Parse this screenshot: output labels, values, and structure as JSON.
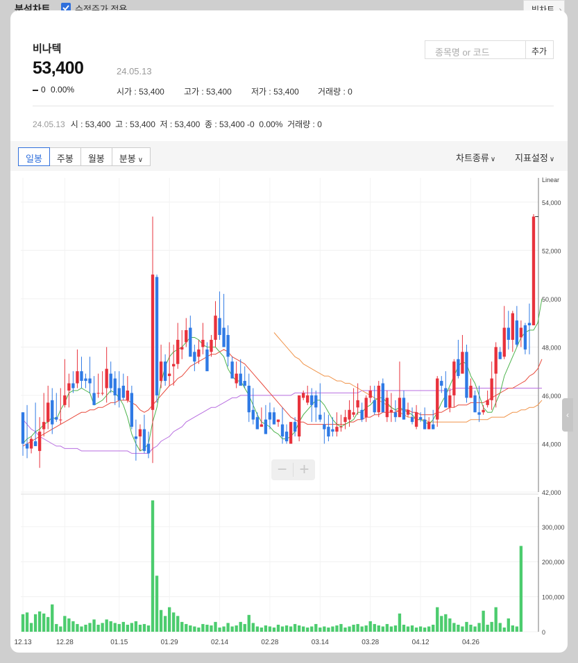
{
  "header": {
    "title": "분석차트",
    "adjusted_label": "수정주가 적용",
    "big_chart_label": "빅차트"
  },
  "stock": {
    "name": "비나텍",
    "price": "53,400",
    "date": "24.05.13",
    "change": "0",
    "change_pct": "0.00%",
    "open": "시가 : 53,400",
    "high": "고가 : 53,400",
    "low": "저가 : 53,400",
    "volume": "거래량 : 0"
  },
  "search": {
    "placeholder": "종목명 or 코드",
    "add_label": "추가"
  },
  "summary": {
    "date": "24.05.13",
    "text": "시 : 53,400  고 : 53,400  저 : 53,400  종 : 53,400 -0  0.00%  거래량 : 0"
  },
  "toolbar": {
    "periods": [
      "일봉",
      "주봉",
      "월봉",
      "분봉"
    ],
    "active_period": "일봉",
    "chart_type": "차트종류",
    "indicator": "지표설정"
  },
  "chart_data": {
    "type": "candlestick",
    "scale_label": "Linear",
    "price_ticks": [
      "54,000",
      "52,000",
      "50,000",
      "48,000",
      "46,000",
      "44,000",
      "42,000"
    ],
    "volume_ticks": [
      "300,000",
      "200,000",
      "100,000",
      "0"
    ],
    "x_labels": [
      "12.13",
      "12.28",
      "01.15",
      "01.29",
      "02.14",
      "02.28",
      "03.14",
      "03.28",
      "04.12",
      "04.26"
    ],
    "ylim": [
      42000,
      55000
    ],
    "volume_ylim": [
      0,
      385000
    ],
    "colors": {
      "up": "#e8323c",
      "down": "#2f7ae5",
      "ma5": "#4cb34c",
      "ma20": "#e84a3c",
      "ma60": "#f0944a",
      "ma120": "#b86ee0",
      "volume": "#4ccc6e"
    },
    "candles": [
      [
        45300,
        45300,
        43500,
        44000
      ],
      [
        44000,
        45600,
        43400,
        43800
      ],
      [
        43800,
        44300,
        43600,
        44200
      ],
      [
        44100,
        45700,
        43900,
        43900
      ],
      [
        43700,
        45100,
        43000,
        44500
      ],
      [
        44600,
        46100,
        44300,
        44900
      ],
      [
        44900,
        46400,
        44600,
        45700
      ],
      [
        45800,
        46300,
        44400,
        44800
      ],
      [
        45100,
        46100,
        44900,
        45000
      ],
      [
        45000,
        46300,
        44800,
        45000
      ],
      [
        45600,
        47500,
        45500,
        46000
      ],
      [
        46200,
        46900,
        45500,
        46500
      ],
      [
        46500,
        47000,
        46100,
        46300
      ],
      [
        46500,
        47900,
        46300,
        47000
      ],
      [
        47000,
        47600,
        46300,
        46600
      ],
      [
        46700,
        46900,
        46300,
        46600
      ],
      [
        46700,
        47600,
        46100,
        46500
      ],
      [
        46100,
        46800,
        45600,
        45600
      ],
      [
        46100,
        46900,
        45900,
        46100
      ],
      [
        46100,
        47000,
        46000,
        46100
      ],
      [
        46300,
        48000,
        45700,
        47100
      ],
      [
        46900,
        47400,
        46100,
        46300
      ],
      [
        46700,
        47000,
        45600,
        46000
      ],
      [
        46300,
        47000,
        45500,
        45800
      ],
      [
        46400,
        46900,
        45800,
        45900
      ],
      [
        45800,
        46800,
        45700,
        46200
      ],
      [
        46100,
        46400,
        44600,
        44700
      ],
      [
        44300,
        45000,
        43300,
        44200
      ],
      [
        44300,
        44800,
        43700,
        44600
      ],
      [
        44600,
        45200,
        43600,
        43700
      ],
      [
        44000,
        44500,
        43400,
        43600
      ],
      [
        45400,
        53400,
        43200,
        51000
      ],
      [
        50900,
        51000,
        45700,
        46000
      ],
      [
        46600,
        48100,
        46300,
        47400
      ],
      [
        47400,
        47700,
        46400,
        46600
      ],
      [
        46800,
        48200,
        46400,
        46900
      ],
      [
        47200,
        48100,
        46400,
        47300
      ],
      [
        47300,
        49000,
        47100,
        48300
      ],
      [
        47900,
        48700,
        47500,
        48000
      ],
      [
        48200,
        49200,
        48000,
        48700
      ],
      [
        48800,
        49300,
        48000,
        47600
      ],
      [
        47800,
        48100,
        47000,
        47400
      ],
      [
        47600,
        48300,
        47300,
        47900
      ],
      [
        48000,
        49000,
        47700,
        48300
      ],
      [
        47900,
        48200,
        47300,
        47000
      ],
      [
        47800,
        48500,
        47600,
        48300
      ],
      [
        48300,
        49900,
        48000,
        49300
      ],
      [
        49200,
        50300,
        48300,
        48500
      ],
      [
        48800,
        50200,
        48100,
        48000
      ],
      [
        48500,
        48900,
        47200,
        47600
      ],
      [
        47400,
        47600,
        46700,
        46700
      ],
      [
        46500,
        47400,
        46300,
        46900
      ],
      [
        46900,
        47500,
        46400,
        46400
      ],
      [
        46600,
        47200,
        46300,
        46400
      ],
      [
        46400,
        46900,
        44900,
        45300
      ],
      [
        45400,
        46300,
        44800,
        45000
      ],
      [
        45100,
        45300,
        44600,
        44600
      ],
      [
        44700,
        45500,
        44700,
        44800
      ],
      [
        45000,
        45600,
        44400,
        44400
      ],
      [
        45300,
        45700,
        44600,
        45000
      ],
      [
        45300,
        45500,
        44800,
        44800
      ],
      [
        44900,
        45000,
        44700,
        45000
      ],
      [
        44800,
        45500,
        44000,
        44300
      ],
      [
        44500,
        44800,
        44000,
        44100
      ],
      [
        44000,
        44900,
        44000,
        44900
      ],
      [
        44900,
        45100,
        44300,
        44500
      ],
      [
        44300,
        46000,
        44100,
        46000
      ],
      [
        45900,
        46200,
        45800,
        46100
      ],
      [
        45700,
        46400,
        45600,
        46000
      ],
      [
        46000,
        46300,
        44900,
        45600
      ],
      [
        46000,
        46200,
        44900,
        45500
      ],
      [
        45200,
        46500,
        44900,
        45000
      ],
      [
        44800,
        45300,
        44000,
        44600
      ],
      [
        44700,
        45200,
        44100,
        44300
      ],
      [
        44600,
        45100,
        44300,
        44500
      ],
      [
        44500,
        45300,
        44300,
        44700
      ],
      [
        44700,
        45200,
        44500,
        44700
      ],
      [
        44900,
        45400,
        44600,
        45100
      ],
      [
        45000,
        45800,
        44700,
        45400
      ],
      [
        45200,
        46300,
        45100,
        45300
      ],
      [
        45500,
        46500,
        45200,
        45800
      ],
      [
        45400,
        45700,
        44900,
        45000
      ],
      [
        45100,
        46000,
        44900,
        45900
      ],
      [
        45900,
        46400,
        45700,
        46200
      ],
      [
        45800,
        46400,
        45200,
        45300
      ],
      [
        45300,
        46600,
        45100,
        46400
      ],
      [
        46500,
        46700,
        45300,
        45300
      ],
      [
        45100,
        46200,
        44900,
        45900
      ],
      [
        45300,
        46100,
        44900,
        45400
      ],
      [
        45300,
        45800,
        44900,
        45100
      ],
      [
        45100,
        47400,
        45100,
        45900
      ],
      [
        45900,
        46200,
        45000,
        45000
      ],
      [
        45200,
        45700,
        45100,
        45400
      ],
      [
        45100,
        45500,
        44800,
        44900
      ],
      [
        44700,
        45600,
        44600,
        45300
      ],
      [
        45100,
        45300,
        44900,
        45000
      ],
      [
        45000,
        45500,
        44600,
        44600
      ],
      [
        44600,
        45100,
        44600,
        44900
      ],
      [
        44800,
        45400,
        44600,
        44600
      ],
      [
        45000,
        46800,
        44700,
        46700
      ],
      [
        46600,
        46800,
        46100,
        46400
      ],
      [
        46300,
        47000,
        45500,
        45500
      ],
      [
        45500,
        46300,
        45300,
        46000
      ],
      [
        46000,
        47500,
        45500,
        47400
      ],
      [
        47500,
        48300,
        46700,
        46800
      ],
      [
        46900,
        48500,
        46900,
        47800
      ],
      [
        47800,
        48100,
        45700,
        45900
      ],
      [
        45900,
        46700,
        45900,
        46400
      ],
      [
        46000,
        46200,
        45300,
        45300
      ],
      [
        45300,
        46400,
        44900,
        45200
      ],
      [
        45300,
        45600,
        45200,
        45400
      ],
      [
        45600,
        46200,
        45500,
        45800
      ],
      [
        45800,
        47400,
        45400,
        46700
      ],
      [
        46900,
        48200,
        45500,
        48000
      ],
      [
        47800,
        48000,
        47500,
        47500
      ],
      [
        47600,
        49700,
        47500,
        48800
      ],
      [
        48800,
        49500,
        47900,
        48300
      ],
      [
        48300,
        49500,
        47800,
        49400
      ],
      [
        49100,
        49700,
        48000,
        48100
      ],
      [
        48400,
        49100,
        48000,
        48800
      ],
      [
        48900,
        49000,
        47700,
        47900
      ],
      [
        49000,
        49800,
        47700,
        48900
      ],
      [
        48900,
        53500,
        48900,
        53400
      ]
    ],
    "ma5": [
      44000,
      44200,
      44300,
      44500,
      44600,
      44800,
      44900,
      45100,
      45000,
      45400,
      45700,
      46100,
      46200,
      46200,
      46300,
      46200,
      46100,
      45600,
      45700,
      45800,
      46000,
      46200,
      46100,
      45900,
      45600,
      45100,
      44400,
      44000,
      43700,
      43800,
      44000,
      44900,
      45500,
      46500,
      47200,
      47600,
      47800,
      47900,
      48000,
      48200,
      48400,
      48400,
      48300,
      48100,
      48000,
      48000,
      48000,
      47800,
      47600,
      47100,
      46800,
      46600,
      46600,
      46300,
      46000,
      45600,
      45200,
      44900,
      44800,
      44700,
      44500,
      44400,
      44200,
      44200,
      44300,
      44500,
      44900,
      45200,
      45400,
      45600,
      45800,
      45800,
      45600,
      45300,
      45000,
      44800,
      44700,
      44800,
      44900,
      45000,
      45300,
      45300,
      45500,
      45600,
      45800,
      45900,
      45900,
      45700,
      45500,
      45400,
      45500,
      45400,
      45300,
      45200,
      45000,
      45000,
      44900,
      44800,
      45000,
      45300,
      45700,
      46000,
      46400,
      46800,
      47200,
      47400,
      47300,
      46800,
      46500,
      46000,
      45500,
      45300,
      45300,
      45700,
      46100,
      46800,
      47200,
      47600,
      48000,
      48400,
      48600,
      48700,
      48700,
      49000,
      50000
    ],
    "ma20": [
      43900,
      44000,
      44100,
      44200,
      44300,
      44400,
      44500,
      44600,
      44700,
      44800,
      44900,
      45000,
      45100,
      45200,
      45300,
      45300,
      45400,
      45400,
      45500,
      45500,
      45600,
      45700,
      45700,
      45800,
      45800,
      45800,
      45700,
      45600,
      45400,
      45300,
      45400,
      45600,
      45800,
      46000,
      46200,
      46400,
      46500,
      46700,
      46800,
      47000,
      47200,
      47300,
      47400,
      47500,
      47600,
      47700,
      47700,
      47800,
      47900,
      47800,
      47600,
      47500,
      47400,
      47300,
      47100,
      46900,
      46700,
      46500,
      46300,
      46100,
      45900,
      45700,
      45500,
      45300,
      45100,
      45000,
      44900,
      44900,
      44800,
      44800,
      44800,
      44800,
      44800,
      44800,
      44800,
      44800,
      44800,
      44800,
      44900,
      44900,
      45000,
      45000,
      45100,
      45100,
      45200,
      45200,
      45300,
      45300,
      45300,
      45300,
      45400,
      45400,
      45400,
      45300,
      45300,
      45200,
      45200,
      45200,
      45200,
      45300,
      45300,
      45400,
      45500,
      45500,
      45600,
      45600,
      45600,
      45700,
      45700,
      45700,
      45700,
      45800,
      45900,
      46000,
      46100,
      46200,
      46300,
      46300,
      46400,
      46500,
      46600,
      46800,
      46900,
      47100,
      47500
    ],
    "ma60": [
      null,
      null,
      null,
      null,
      null,
      null,
      null,
      null,
      null,
      null,
      null,
      null,
      null,
      null,
      null,
      null,
      null,
      null,
      null,
      null,
      null,
      null,
      null,
      null,
      null,
      null,
      null,
      null,
      null,
      null,
      null,
      null,
      null,
      null,
      null,
      null,
      null,
      null,
      null,
      null,
      null,
      null,
      null,
      null,
      null,
      null,
      null,
      null,
      null,
      null,
      null,
      null,
      null,
      null,
      null,
      null,
      null,
      null,
      null,
      null,
      48600,
      48400,
      48200,
      48000,
      47800,
      47600,
      47500,
      47300,
      47200,
      47100,
      47000,
      46900,
      46800,
      46800,
      46700,
      46600,
      46600,
      46500,
      46500,
      46400,
      46300,
      46200,
      46100,
      46000,
      45900,
      45800,
      45700,
      45600,
      45500,
      45400,
      45300,
      45200,
      45100,
      45100,
      45000,
      45000,
      45000,
      44900,
      44900,
      44900,
      44900,
      44900,
      44900,
      44900,
      44900,
      44900,
      44900,
      45000,
      45000,
      45000,
      45000,
      45000,
      45100,
      45100,
      45100,
      45100,
      45200,
      45300,
      45300,
      45400,
      45400,
      45500,
      45500,
      45600,
      45800
    ],
    "ma120": [
      45000,
      44800,
      44600,
      44500,
      44300,
      44200,
      44100,
      44000,
      43900,
      43900,
      43800,
      43800,
      43800,
      43800,
      43700,
      43700,
      43700,
      43700,
      43700,
      43700,
      43700,
      43700,
      43700,
      43700,
      43700,
      43700,
      43600,
      43600,
      43600,
      43600,
      43600,
      43800,
      43900,
      44100,
      44200,
      44300,
      44500,
      44600,
      44700,
      44900,
      45000,
      45100,
      45200,
      45300,
      45400,
      45500,
      45500,
      45600,
      45700,
      45800,
      45900,
      45900,
      46000,
      46000,
      46000,
      46000,
      46000,
      46000,
      46000,
      46000,
      46000,
      46000,
      46000,
      46000,
      46000,
      46100,
      46100,
      46100,
      46100,
      46100,
      46100,
      46100,
      46100,
      46100,
      46100,
      46100,
      46100,
      46100,
      46100,
      46100,
      46100,
      46200,
      46200,
      46200,
      46200,
      46200,
      46200,
      46200,
      46200,
      46200,
      46200,
      46200,
      46200,
      46200,
      46200,
      46200,
      46200,
      46200,
      46200,
      46200,
      46200,
      46200,
      46200,
      46300,
      46300,
      46300,
      46300,
      46300,
      46300,
      46300,
      46300,
      46300,
      46300,
      46300,
      46300,
      46300,
      46300,
      46300,
      46300,
      46300,
      46300,
      46300,
      46300,
      46300,
      46300
    ],
    "volume": [
      50000,
      55000,
      25000,
      50000,
      58000,
      52000,
      42000,
      78000,
      22000,
      15000,
      45000,
      38000,
      30000,
      22000,
      15000,
      20000,
      25000,
      35000,
      20000,
      25000,
      35000,
      30000,
      25000,
      22000,
      28000,
      20000,
      25000,
      30000,
      20000,
      22000,
      18000,
      375000,
      160000,
      62000,
      45000,
      70000,
      55000,
      45000,
      28000,
      22000,
      18000,
      15000,
      12000,
      22000,
      20000,
      18000,
      28000,
      12000,
      15000,
      25000,
      15000,
      18000,
      28000,
      22000,
      48000,
      25000,
      15000,
      12000,
      18000,
      15000,
      12000,
      20000,
      15000,
      18000,
      15000,
      22000,
      18000,
      15000,
      12000,
      15000,
      22000,
      12000,
      15000,
      12000,
      15000,
      18000,
      22000,
      12000,
      15000,
      20000,
      22000,
      15000,
      18000,
      30000,
      22000,
      18000,
      15000,
      22000,
      15000,
      18000,
      52000,
      20000,
      15000,
      18000,
      12000,
      15000,
      12000,
      15000,
      20000,
      70000,
      45000,
      50000,
      38000,
      25000,
      20000,
      15000,
      28000,
      20000,
      15000,
      25000,
      60000,
      20000,
      28000,
      70000,
      25000,
      12000,
      38000,
      18000,
      15000,
      245000
    ]
  }
}
